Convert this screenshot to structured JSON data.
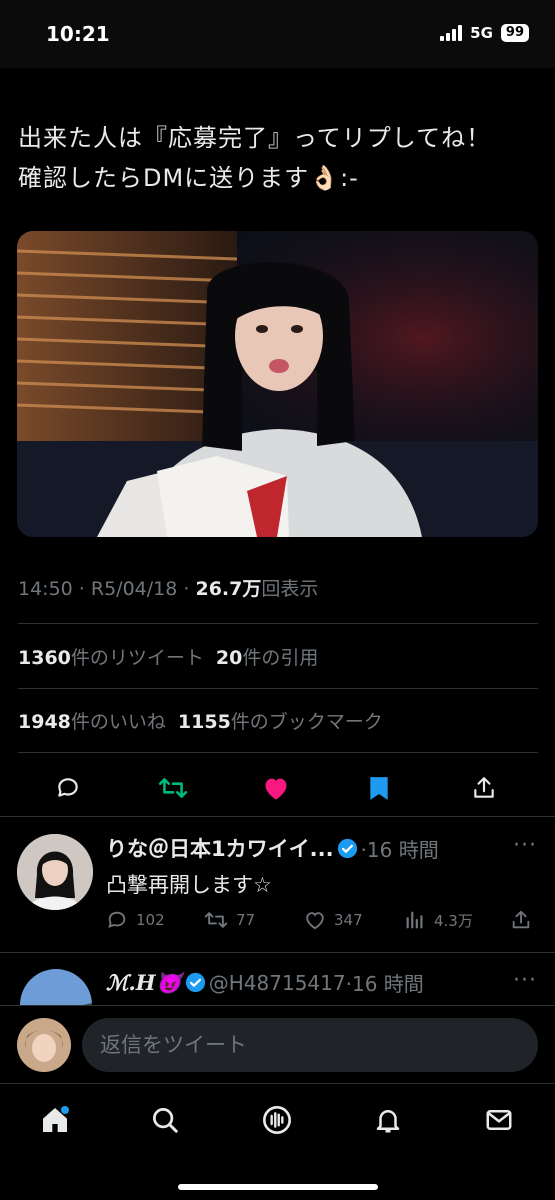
{
  "status_bar": {
    "time": "10:21",
    "network": "5G",
    "battery": "99"
  },
  "tweet": {
    "text_line1": "出来た人は『応募完了』ってリプしてね！",
    "text_line2": "確認したらDMに送ります👌🏻:-",
    "time": "14:50",
    "sep1": " · ",
    "date": "R5/04/18",
    "sep2": " · ",
    "views_value": "26.7万",
    "views_label": "回表示",
    "retweets_value": "1360",
    "retweets_label": "件のリツイート",
    "quotes_value": "20",
    "quotes_label": "件の引用",
    "likes_value": "1948",
    "likes_label": "件のいいね",
    "bookmarks_value": "1155",
    "bookmarks_label": "件のブックマーク"
  },
  "replies": [
    {
      "name": "りな＠日本1カワイイ...",
      "meta": "·16 時間",
      "more": "···",
      "text": "凸撃再開します☆",
      "reply_count": "102",
      "retweet_count": "77",
      "like_count": "347",
      "view_count": "4.3万"
    },
    {
      "name": "ℳ.H😈",
      "handle": "@H48715417",
      "meta": "·16 時間",
      "more": "···"
    }
  ],
  "compose": {
    "placeholder": "返信をツイート"
  },
  "colors": {
    "background": "#000000",
    "text": "#e7e9ea",
    "muted": "#71767b",
    "retweet_green": "#00ba7c",
    "like_pink": "#f91880",
    "accent_blue": "#1d9bf0"
  },
  "icons": {
    "actions": [
      "reply-icon",
      "retweet-icon",
      "heart-icon",
      "bookmark-icon",
      "share-icon"
    ],
    "tabs": [
      "home-icon",
      "search-icon",
      "spaces-icon",
      "notifications-icon",
      "messages-icon"
    ]
  }
}
